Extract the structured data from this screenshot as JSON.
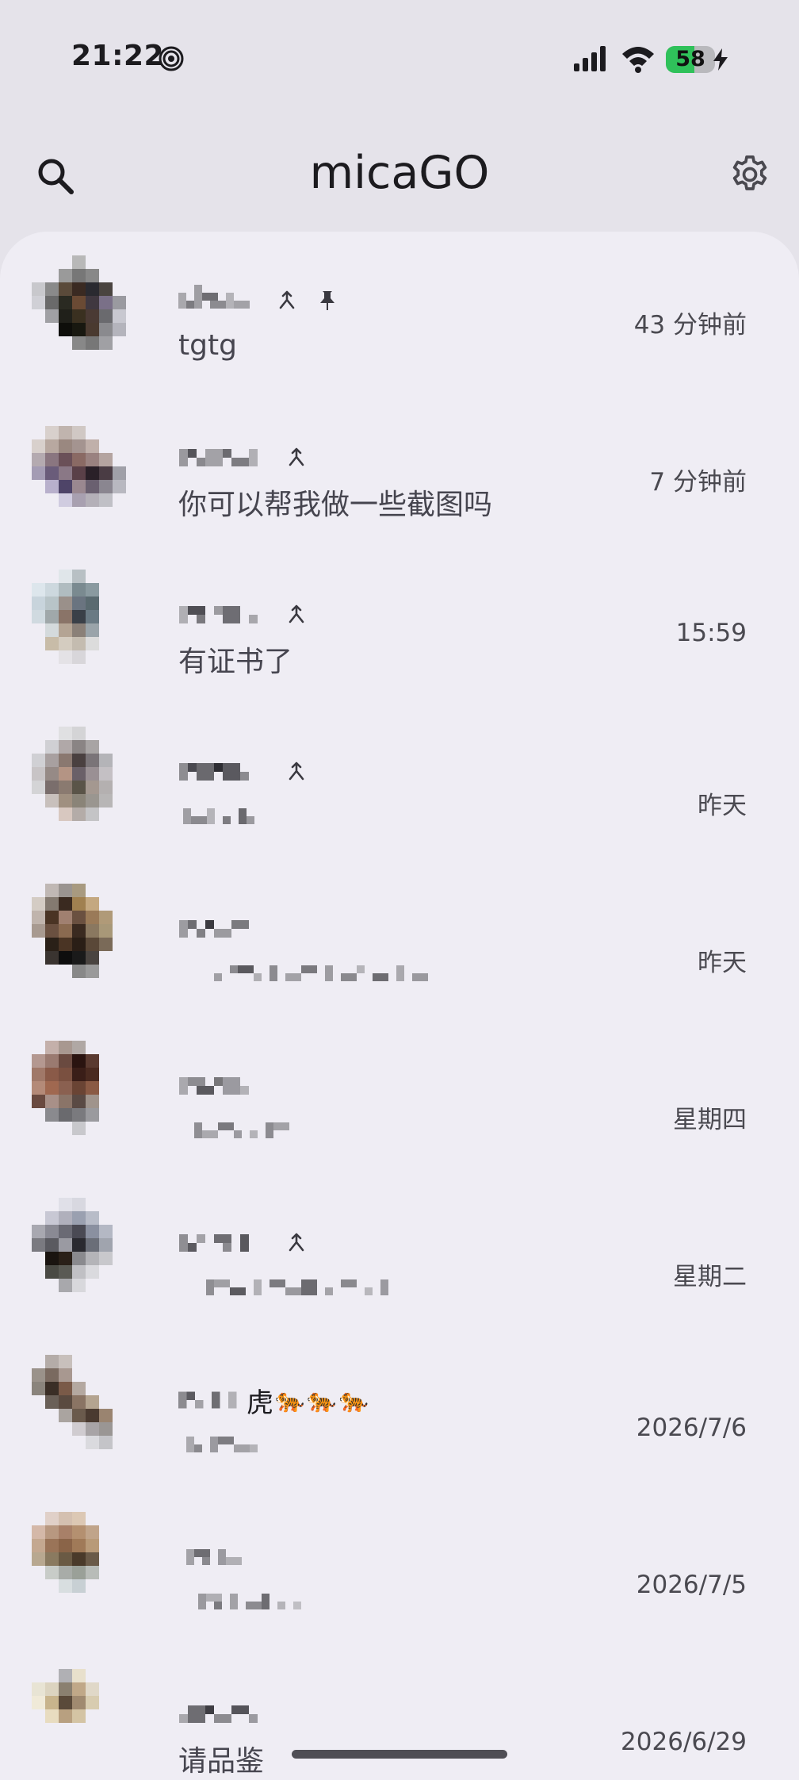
{
  "status_bar": {
    "time": "21:22",
    "battery_level": "58",
    "battery_percent": 58,
    "icons": [
      "hotspot-icon",
      "signal-icon",
      "wifi-icon",
      "battery-icon",
      "charging-icon"
    ]
  },
  "app_bar": {
    "title": "micaGO",
    "search_icon": "search-icon",
    "settings_icon": "gear-icon"
  },
  "chats": [
    {
      "name_visible": "",
      "preview": "tgtg",
      "time": "43 分钟前",
      "pinned": true,
      "synced": true
    },
    {
      "name_visible": "",
      "preview": "你可以帮我做一些截图吗",
      "time": "7 分钟前",
      "pinned": false,
      "synced": true
    },
    {
      "name_visible": "",
      "preview": "有证书了",
      "time": "15:59",
      "pinned": false,
      "synced": true
    },
    {
      "name_visible": "",
      "preview": "",
      "time": "昨天",
      "pinned": false,
      "synced": true
    },
    {
      "name_visible": "",
      "preview": "",
      "time": "昨天",
      "pinned": false,
      "synced": false
    },
    {
      "name_visible": "",
      "preview": "",
      "time": "星期四",
      "pinned": false,
      "synced": false
    },
    {
      "name_visible": "",
      "preview": "",
      "time": "星期二",
      "pinned": false,
      "synced": true
    },
    {
      "name_visible": "虎",
      "name_emoji": "🐅🐅🐅",
      "preview": "",
      "time": "2026/7/6",
      "pinned": false,
      "synced": false
    },
    {
      "name_visible": "",
      "preview": "",
      "time": "2026/7/5",
      "pinned": false,
      "synced": false
    },
    {
      "name_visible": "",
      "preview": "请品鉴",
      "time": "2026/6/29",
      "pinned": false,
      "synced": false
    }
  ],
  "colors": {
    "background": "#e5e3ea",
    "panel": "#efedf4",
    "text_primary": "#1c1b1f",
    "text_secondary": "#4a4950",
    "battery_fill": "#2fc15a"
  }
}
